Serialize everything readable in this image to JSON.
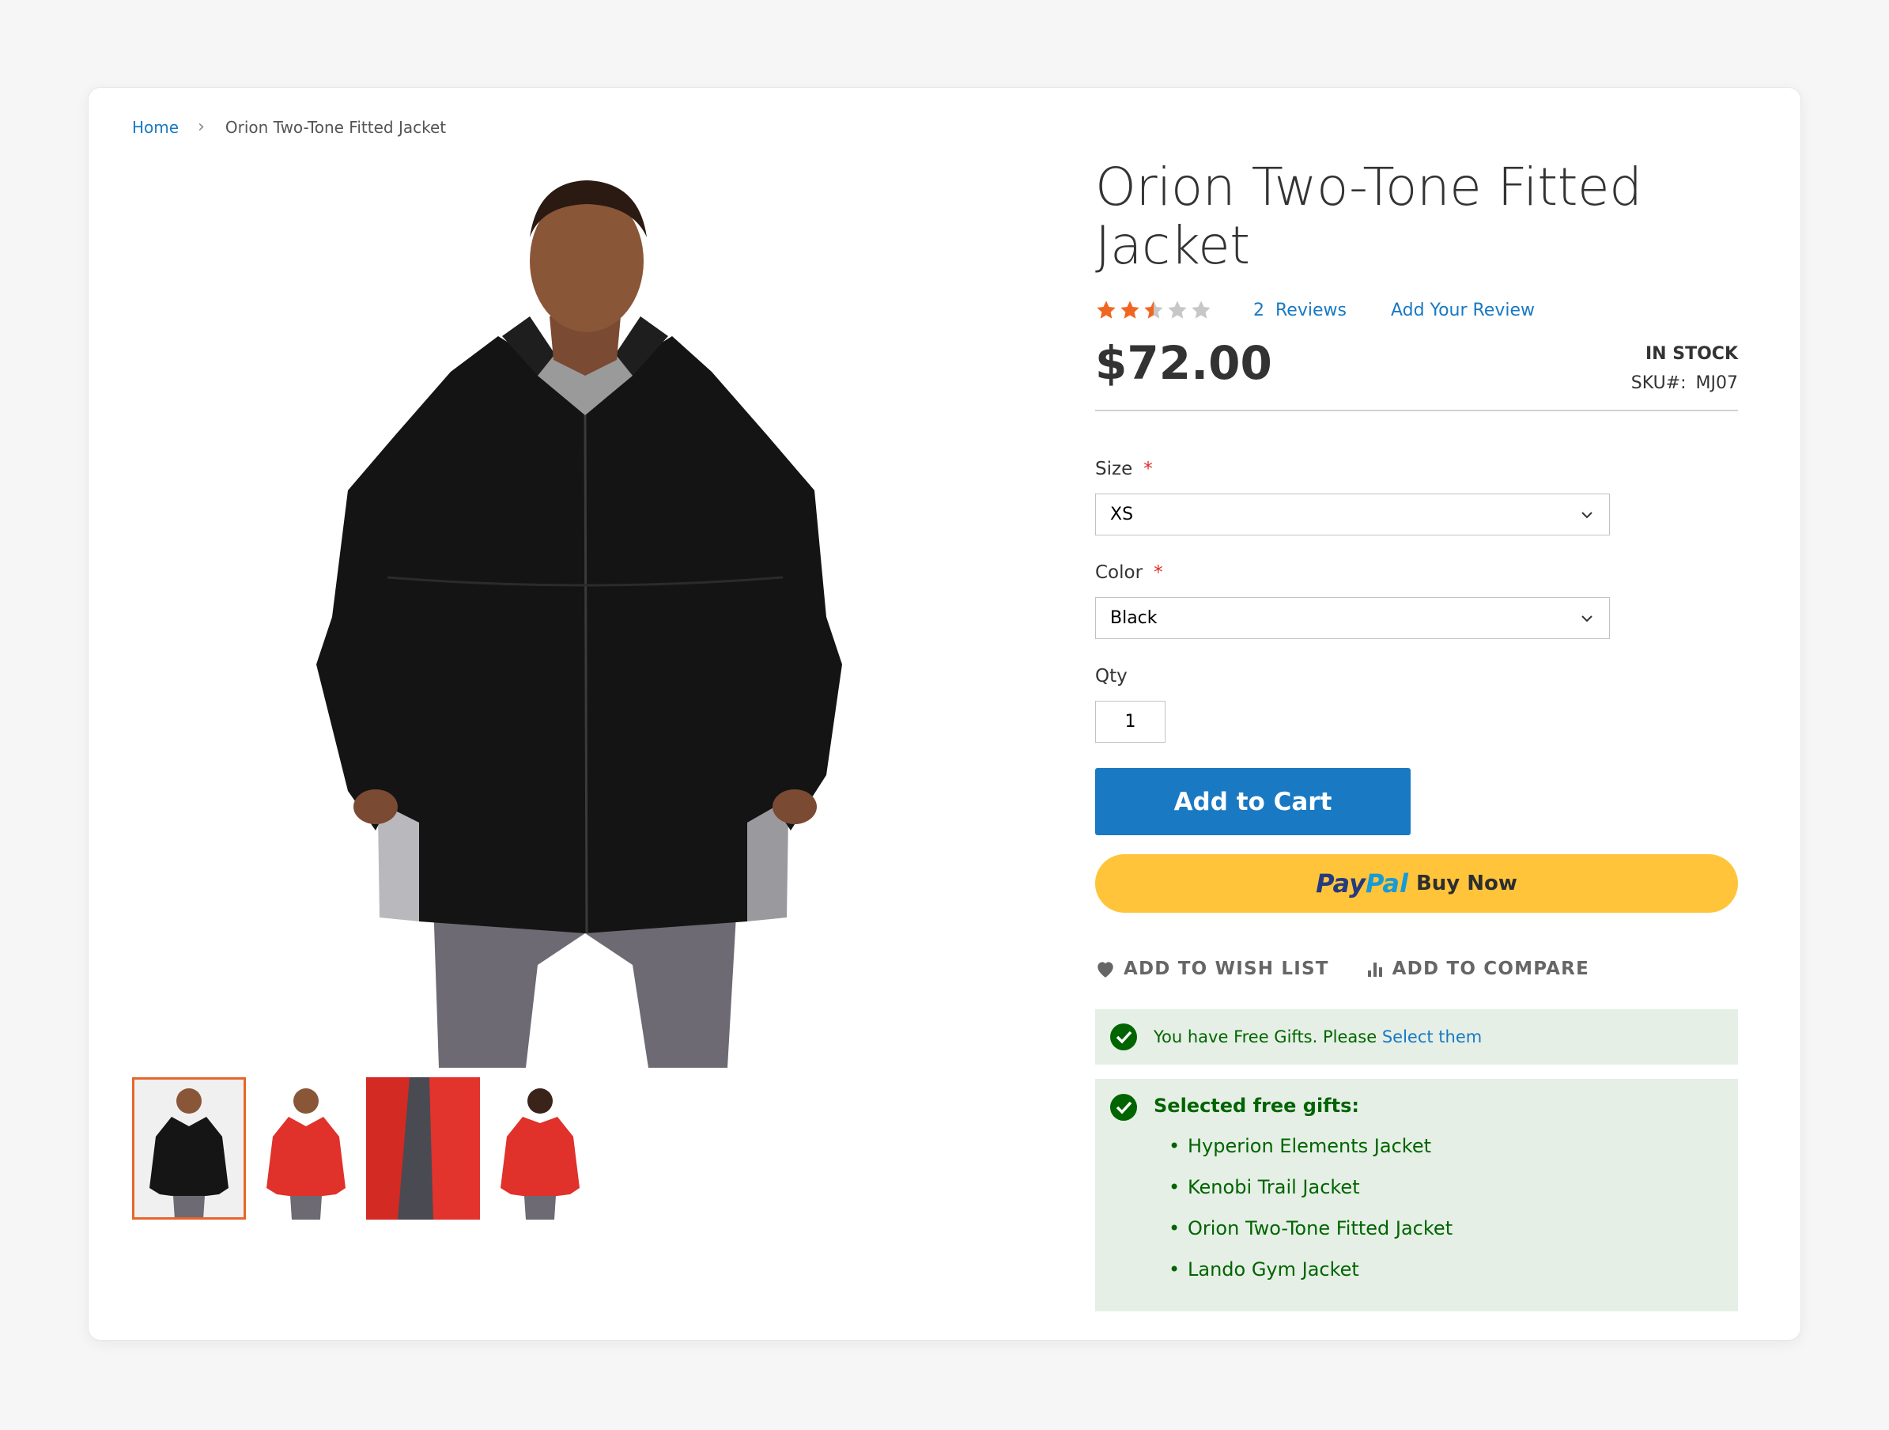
{
  "breadcrumb": {
    "home": "Home",
    "current": "Orion Two-Tone Fitted Jacket"
  },
  "product": {
    "title": "Orion Two-Tone Fitted Jacket",
    "rating_stars": 2.5,
    "rating_max": 5,
    "reviews_count": "2",
    "reviews_label": "Reviews",
    "add_review": "Add Your Review",
    "price": "$72.00",
    "stock": "IN STOCK",
    "sku_label": "SKU#:",
    "sku": "MJ07"
  },
  "options": {
    "size_label": "Size",
    "size_value": "XS",
    "color_label": "Color",
    "color_value": "Black",
    "qty_label": "Qty",
    "qty_value": "1",
    "required_mark": "*"
  },
  "buttons": {
    "add_to_cart": "Add to Cart",
    "paypal_pay": "Pay",
    "paypal_pal": "Pal",
    "paypal_buy_now": "Buy Now",
    "wish_list": "ADD TO WISH LIST",
    "compare": "ADD TO COMPARE"
  },
  "gifts": {
    "notice_prefix": "You have Free Gifts. Please",
    "notice_link": "Select them",
    "selected_heading": "Selected free gifts:",
    "items": [
      "Hyperion Elements Jacket",
      "Kenobi Trail Jacket",
      "Orion Two-Tone Fitted Jacket",
      "Lando Gym Jacket"
    ]
  },
  "colors": {
    "link": "#1979c3",
    "star_on": "#f16522",
    "star_off": "#c7c7c7",
    "paypal_yellow": "#ffc439",
    "success_bg": "#e5efe5",
    "success_text": "#006400"
  }
}
